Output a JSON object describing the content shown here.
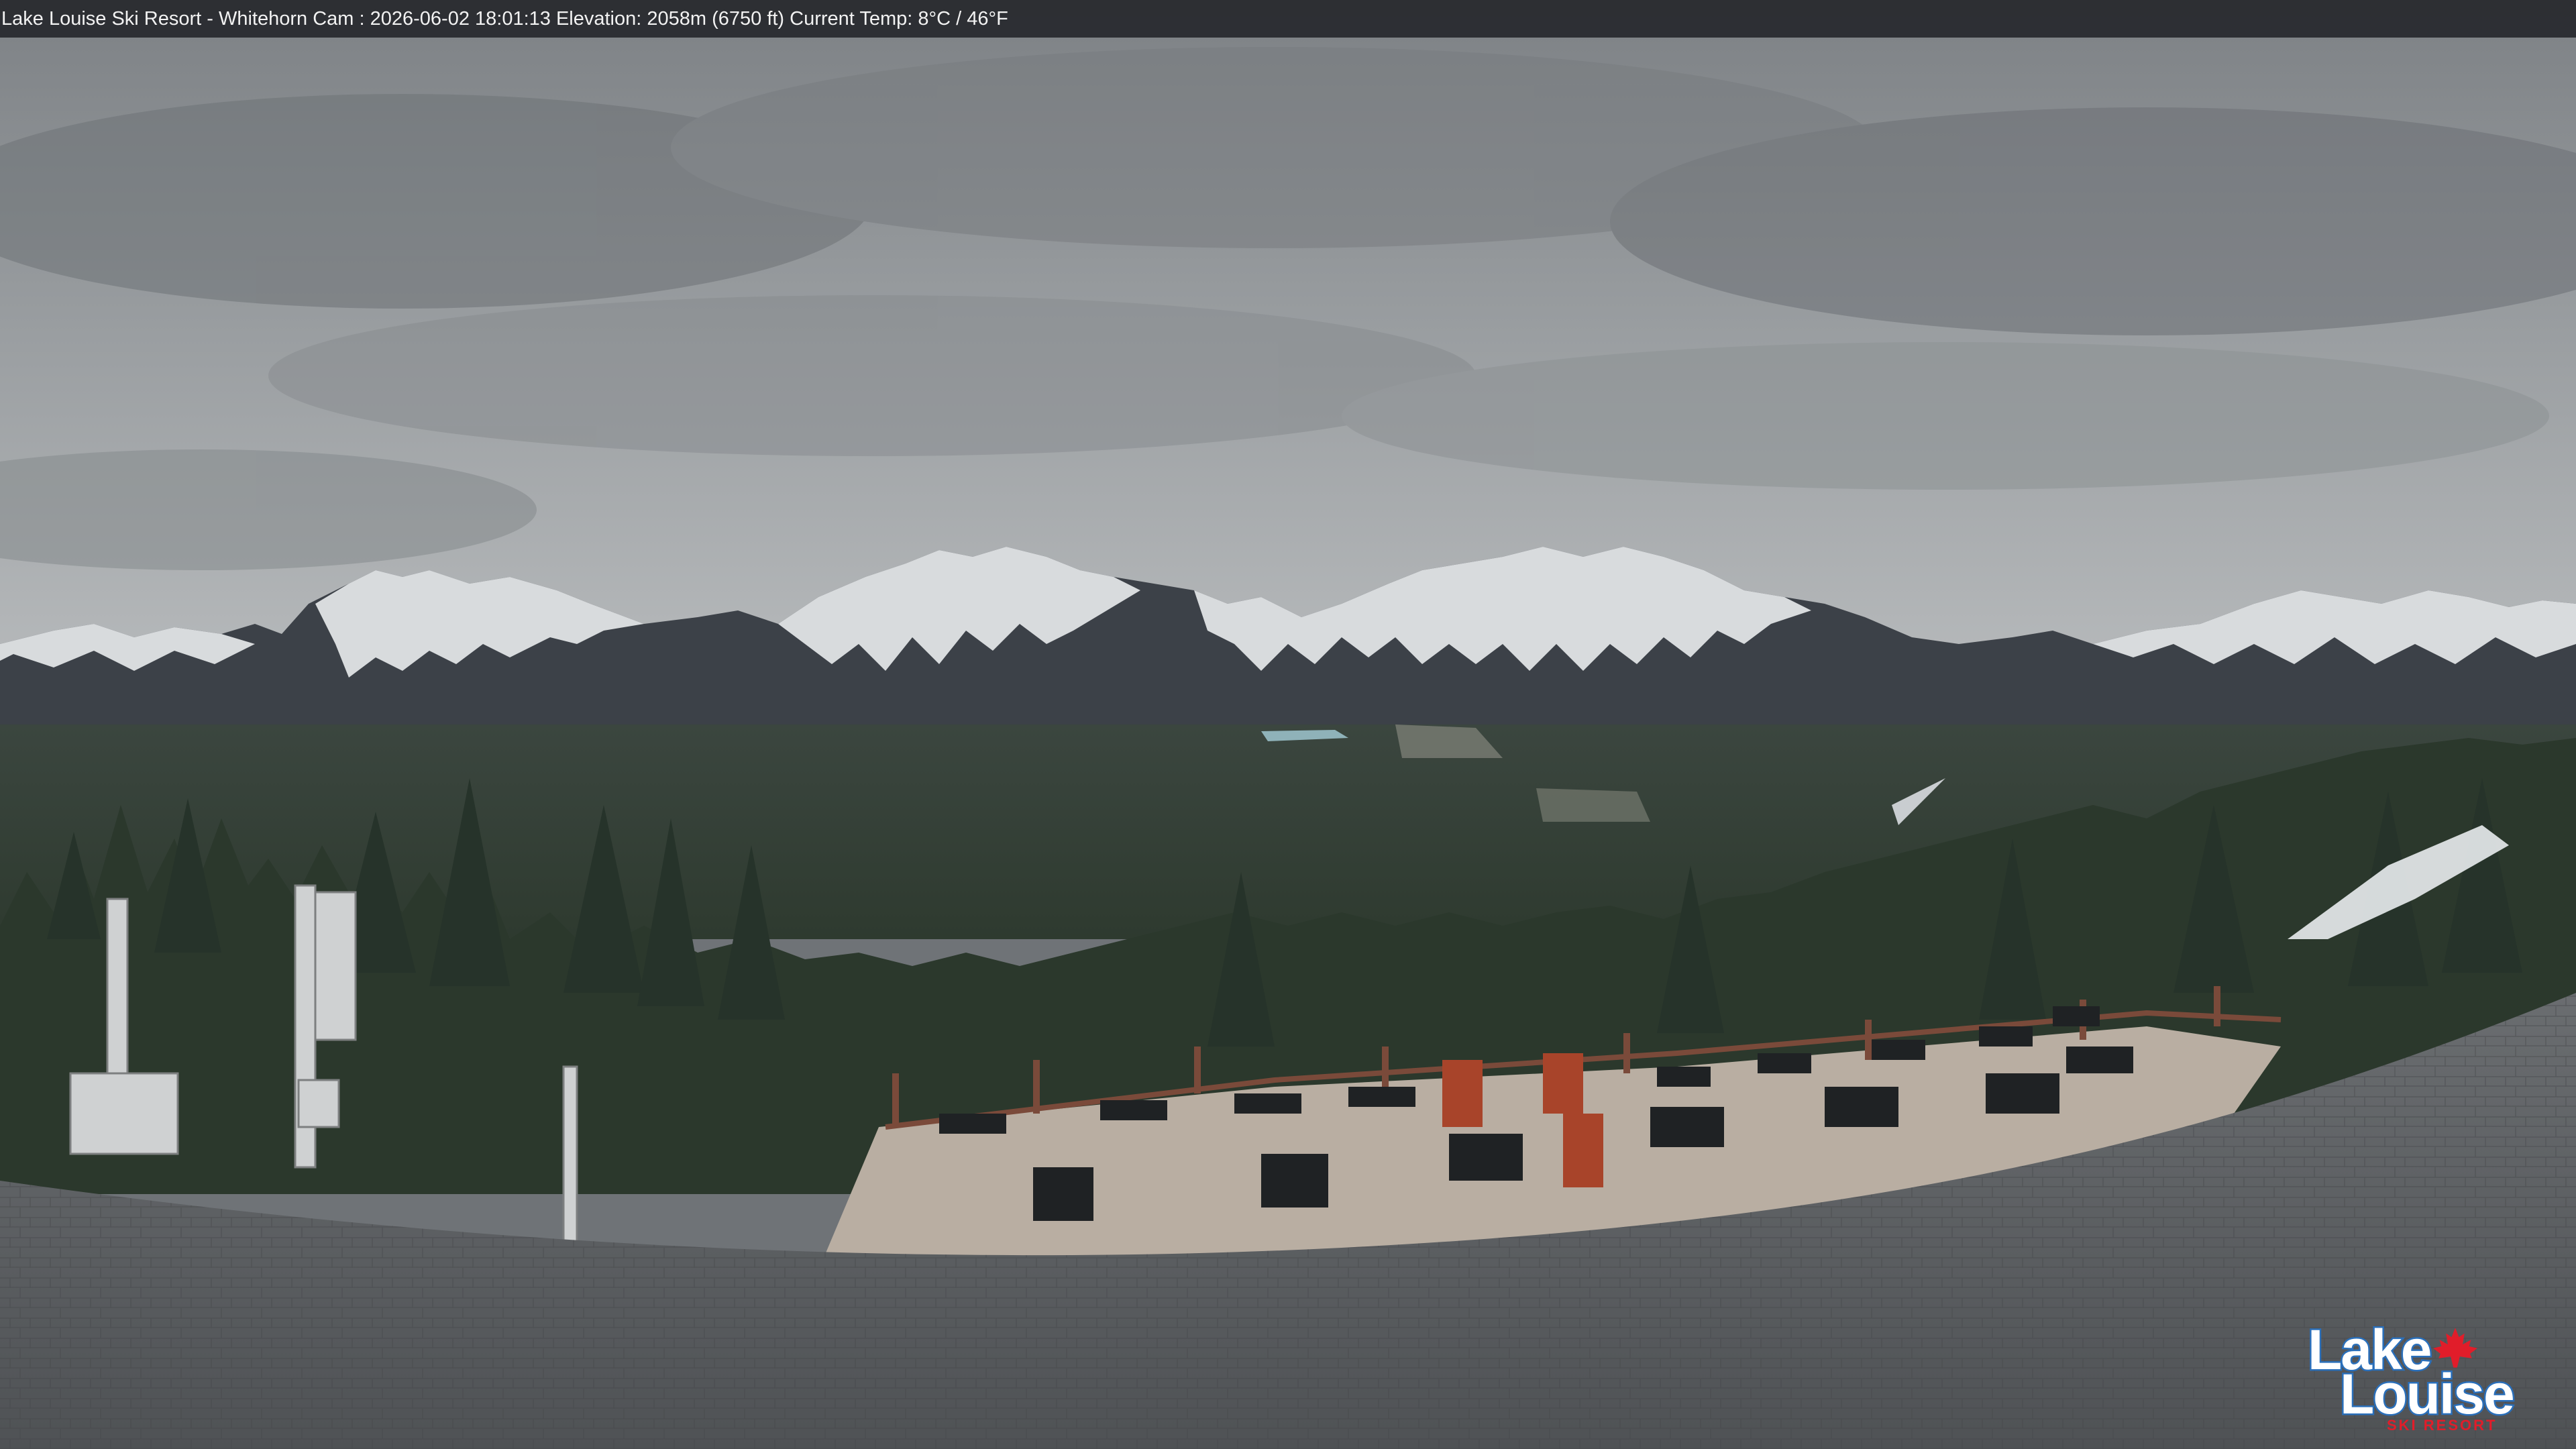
{
  "camera": {
    "info_text": "Lake Louise Ski Resort - Whitehorn Cam : 2026-06-02 18:01:13  Elevation: 2058m (6750 ft) Current Temp: 8°C / 46°F"
  },
  "logo": {
    "line1": "Lake",
    "line2": "Louise",
    "tagline": "SKI RESORT"
  },
  "colors": {
    "sky": "#8f9396",
    "mountain_snow": "#e6e8ea",
    "forest": "#2f3d2f",
    "roof": "#5d6063",
    "deck": "#b9aea2",
    "logo_blue": "#2a6fba",
    "logo_red": "#e11d2a"
  }
}
